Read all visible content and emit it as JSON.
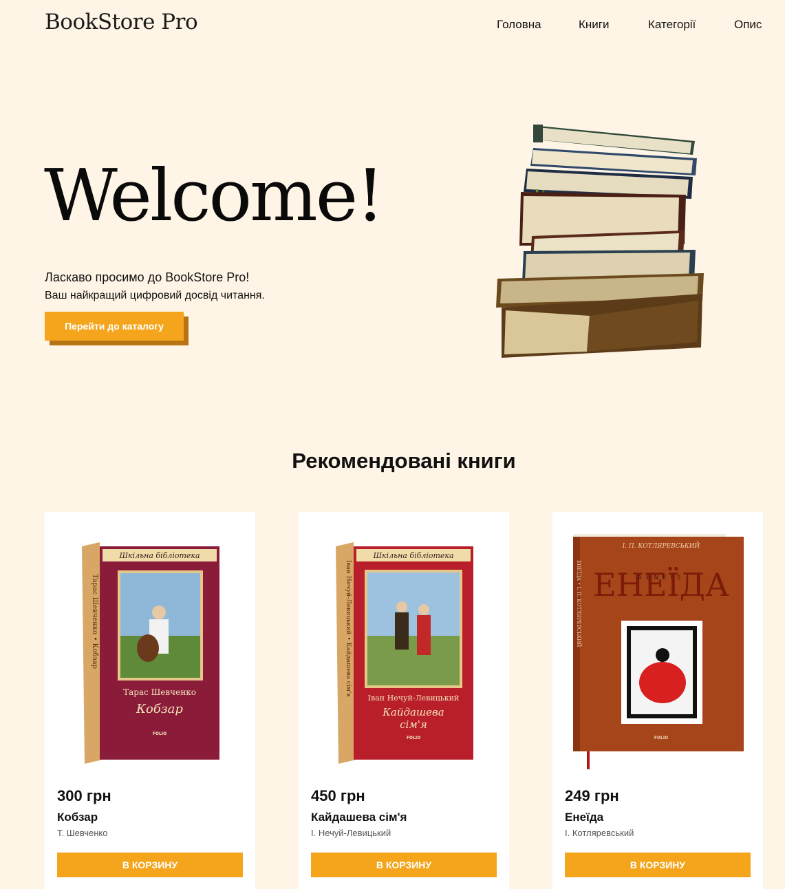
{
  "header": {
    "logo": "BookStore Pro",
    "nav": [
      {
        "label": "Головна"
      },
      {
        "label": "Книги"
      },
      {
        "label": "Категорії"
      },
      {
        "label": "Опис"
      }
    ]
  },
  "hero": {
    "title": "Welcome!",
    "subtitle_line1": "Ласкаво просимо до BookStore Pro!",
    "subtitle_line2": "Ваш найкращий цифровий досвід читання.",
    "cta_label": "Перейти до каталогу"
  },
  "featured": {
    "heading": "Рекомендовані книги",
    "books": [
      {
        "price": "300 грн",
        "title": "Кобзар",
        "author": "Т. Шевченко",
        "button": "В КОРЗИНУ",
        "cover": {
          "series": "Шкільна бібліотека",
          "author": "Тарас Шевченко",
          "title": "Кобзар",
          "spine": "Тарас Шевченко • Кобзар",
          "publisher": "FOLIO"
        }
      },
      {
        "price": "450 грн",
        "title": "Кайдашева сім'я",
        "author": "І. Нечуй-Левицький",
        "button": "В КОРЗИНУ",
        "cover": {
          "series": "Шкільна бібліотека",
          "author": "Іван Нечуй-Левицький",
          "title": "Кайдашева",
          "title2": "сім'я",
          "spine": "Іван Нечуй-Левицький • Кайдашева сім'я",
          "publisher": "FOLIO"
        }
      },
      {
        "price": "249 грн",
        "title": "Енеїда",
        "author": "І. Котляревський",
        "button": "В КОРЗИНУ",
        "cover": {
          "author": "І. П. КОТЛЯРЕВСЬКИЙ",
          "title": "ЕНЕЇДА",
          "latin": "AENEIS",
          "spine": "ЕНЕЇДА • І. П. КОТЛЯРЕВСЬКИЙ",
          "publisher": "FOLIO"
        }
      }
    ]
  },
  "colors": {
    "background": "#fff5e6",
    "accent": "#f4a51c",
    "accent_shadow": "#b87412",
    "card": "#ffffff"
  }
}
